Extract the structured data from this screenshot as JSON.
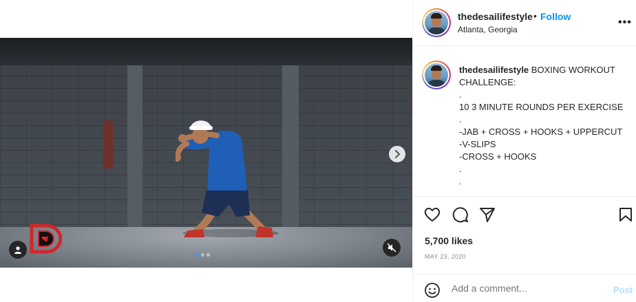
{
  "header": {
    "username": "thedesailifestyle",
    "separator": "•",
    "follow_label": "Follow",
    "location": "Atlanta, Georgia",
    "more_label": "•••"
  },
  "caption": {
    "username": "thedesailifestyle",
    "lines": [
      "BOXING WORKOUT CHALLENGE:",
      ".",
      "10 3 MINUTE ROUNDS PER EXERCISE",
      ".",
      "-JAB + CROSS + HOOKS + UPPERCUT",
      "-V-SLIPS",
      "-CROSS + HOOKS",
      ".",
      "."
    ]
  },
  "media": {
    "carousel_dots": 3,
    "active_dot": 0
  },
  "actions": {
    "like_icon": "heart-icon",
    "comment_icon": "comment-icon",
    "share_icon": "paper-plane-icon",
    "save_icon": "bookmark-icon"
  },
  "likes_text": "5,700 likes",
  "date_text": "MAY 23, 2020",
  "comment": {
    "placeholder": "Add a comment...",
    "post_label": "Post"
  },
  "colors": {
    "link_blue": "#0095f6",
    "post_disabled": "#b2dffc",
    "text": "#262626",
    "muted": "#8e8e8e"
  }
}
